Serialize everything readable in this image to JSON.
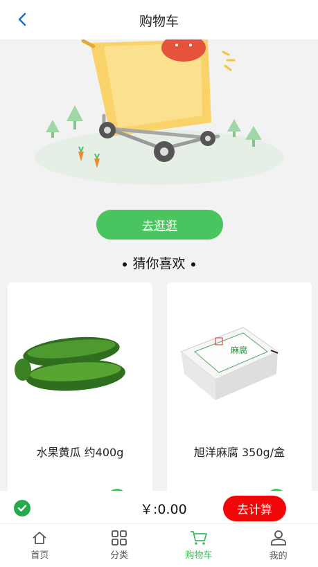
{
  "header": {
    "title": "购物车"
  },
  "hero": {
    "button_label": "去逛逛"
  },
  "recommend": {
    "title": "猜你喜欢",
    "products": [
      {
        "name": "水果黄瓜 约400g"
      },
      {
        "name": "旭洋麻腐 350g/盒",
        "package_text": "麻腐"
      }
    ]
  },
  "checkout": {
    "total": "￥:0.00",
    "settle_label": "去计算",
    "check_color": "#26a94a",
    "settle_color": "#f00808"
  },
  "tabbar": {
    "items": [
      {
        "label": "首页",
        "icon": "home-icon"
      },
      {
        "label": "分类",
        "icon": "category-grid-icon"
      },
      {
        "label": "购物车",
        "icon": "shopping-cart-icon",
        "active": true
      },
      {
        "label": "我的",
        "icon": "user-icon"
      }
    ],
    "active_color": "#3cbf5a"
  },
  "accent_color": "#4ac45f"
}
